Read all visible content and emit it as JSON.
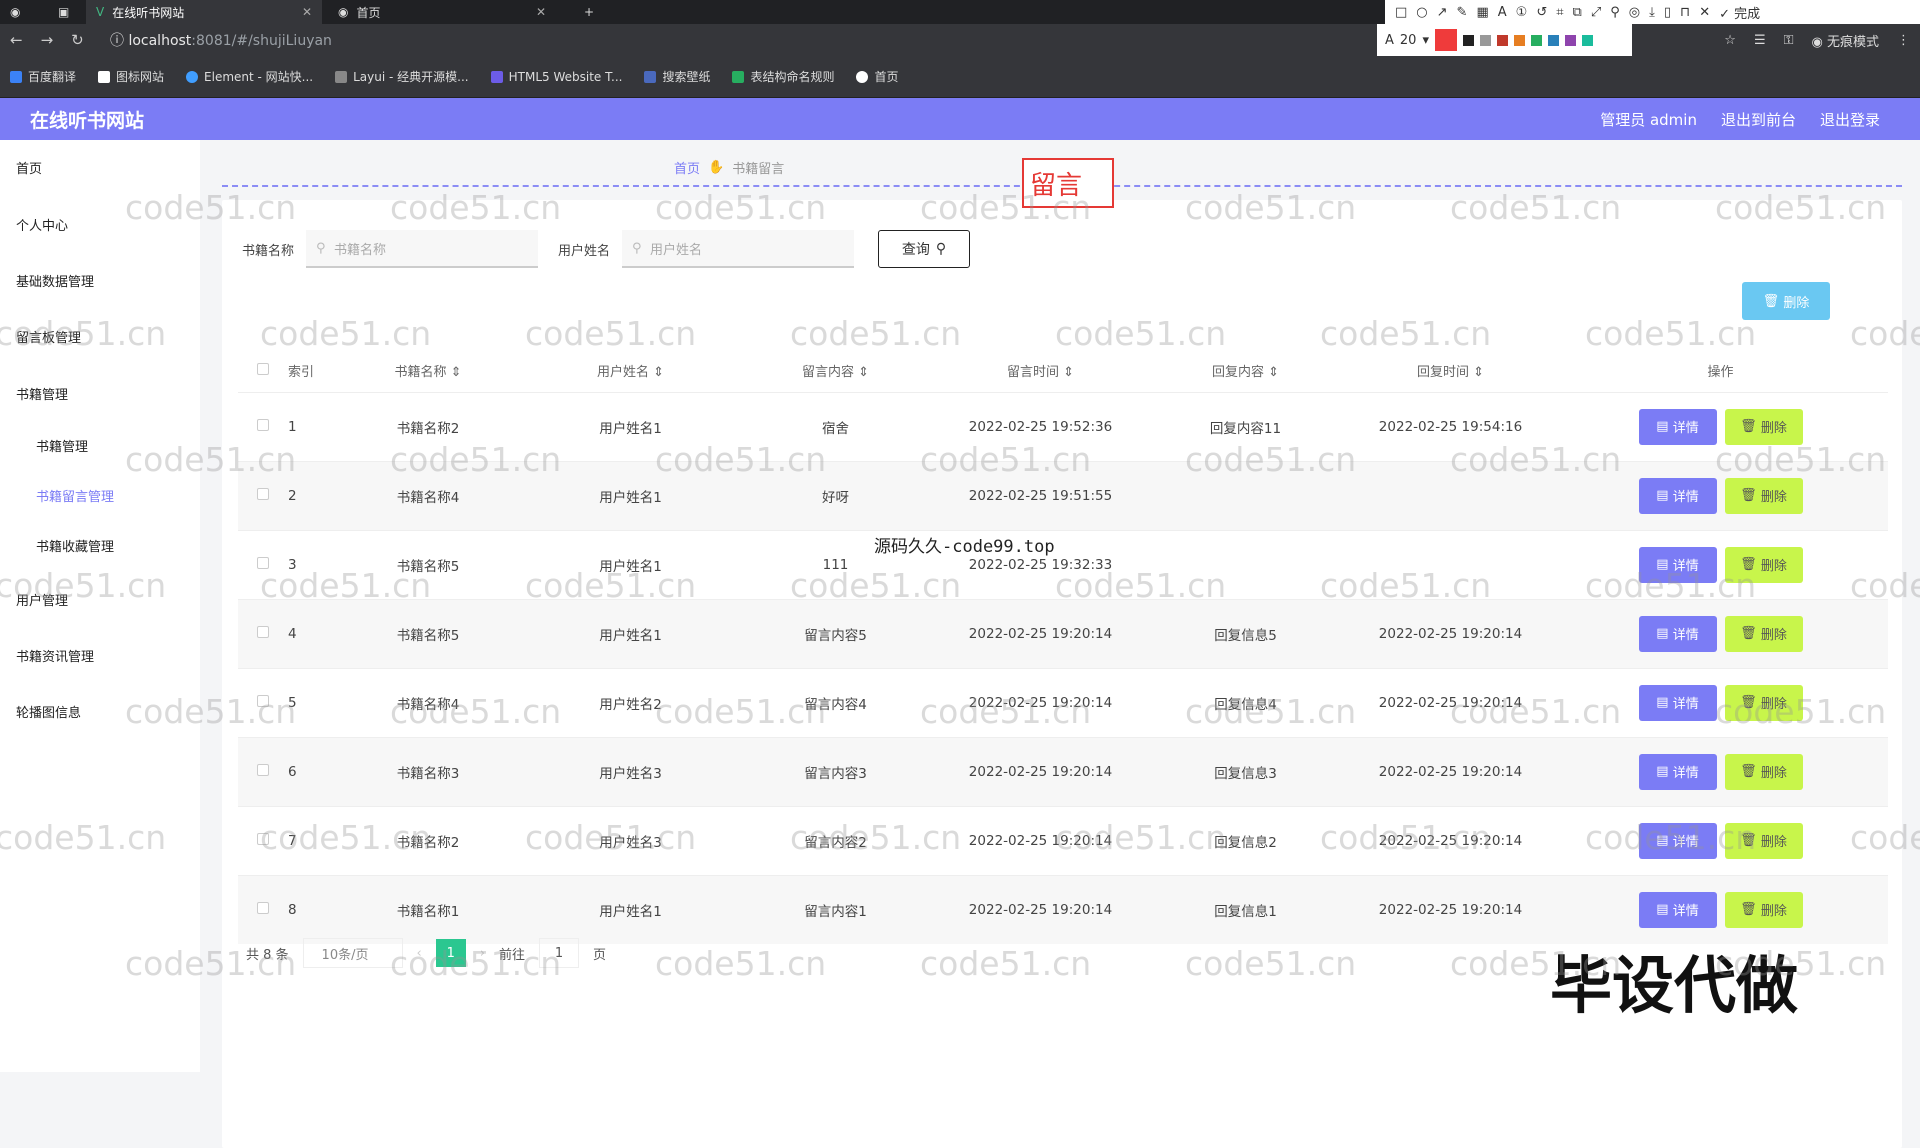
{
  "browser": {
    "tabs": [
      {
        "title": "在线听书网站"
      },
      {
        "title": "首页"
      }
    ],
    "url_host": "localhost",
    "url_path": ":8081/#/shujiLiuyan",
    "font_size": "20",
    "profile": "无痕模式",
    "done": "完成",
    "bookmarks": [
      "百度翻译",
      "图标网站",
      "Element - 网站快...",
      "Layui - 经典开源模...",
      "HTML5 Website T...",
      "搜索壁纸",
      "表结构命名规则",
      "首页"
    ]
  },
  "app": {
    "brand": "在线听书网站",
    "header_links": [
      "管理员 admin",
      "退出到前台",
      "退出登录"
    ]
  },
  "sidebar": {
    "items": [
      {
        "label": "首页",
        "level": 1,
        "active": false
      },
      {
        "label": "个人中心",
        "level": 1,
        "active": false
      },
      {
        "label": "基础数据管理",
        "level": 1,
        "active": false
      },
      {
        "label": "留言板管理",
        "level": 1,
        "active": false
      },
      {
        "label": "书籍管理",
        "level": 1,
        "active": false
      },
      {
        "label": "书籍管理",
        "level": 2,
        "active": false
      },
      {
        "label": "书籍留言管理",
        "level": 2,
        "active": true
      },
      {
        "label": "书籍收藏管理",
        "level": 2,
        "active": false
      },
      {
        "label": "用户管理",
        "level": 1,
        "active": false
      },
      {
        "label": "书籍资讯管理",
        "level": 1,
        "active": false
      },
      {
        "label": "轮播图信息",
        "level": 1,
        "active": false
      }
    ]
  },
  "breadcrumb": {
    "home": "首页",
    "current": "书籍留言"
  },
  "filters": {
    "book_label": "书籍名称",
    "book_placeholder": "书籍名称",
    "user_label": "用户姓名",
    "user_placeholder": "用户姓名",
    "search_label": "查询"
  },
  "annotation_text": "留言",
  "bulk_delete_label": "删除",
  "table": {
    "headers": [
      "索引",
      "书籍名称",
      "用户姓名",
      "留言内容",
      "留言时间",
      "回复内容",
      "回复时间",
      "操作"
    ],
    "detail_label": "详情",
    "delete_label": "删除",
    "rows": [
      [
        "1",
        "书籍名称2",
        "用户姓名1",
        "宿舍",
        "2022-02-25 19:52:36",
        "回复内容11",
        "2022-02-25 19:54:16"
      ],
      [
        "2",
        "书籍名称4",
        "用户姓名1",
        "好呀",
        "2022-02-25 19:51:55",
        "",
        ""
      ],
      [
        "3",
        "书籍名称5",
        "用户姓名1",
        "111",
        "2022-02-25 19:32:33",
        "",
        ""
      ],
      [
        "4",
        "书籍名称5",
        "用户姓名1",
        "留言内容5",
        "2022-02-25 19:20:14",
        "回复信息5",
        "2022-02-25 19:20:14"
      ],
      [
        "5",
        "书籍名称4",
        "用户姓名2",
        "留言内容4",
        "2022-02-25 19:20:14",
        "回复信息4",
        "2022-02-25 19:20:14"
      ],
      [
        "6",
        "书籍名称3",
        "用户姓名3",
        "留言内容3",
        "2022-02-25 19:20:14",
        "回复信息3",
        "2022-02-25 19:20:14"
      ],
      [
        "7",
        "书籍名称2",
        "用户姓名3",
        "留言内容2",
        "2022-02-25 19:20:14",
        "回复信息2",
        "2022-02-25 19:20:14"
      ],
      [
        "8",
        "书籍名称1",
        "用户姓名1",
        "留言内容1",
        "2022-02-25 19:20:14",
        "回复信息1",
        "2022-02-25 19:20:14"
      ]
    ]
  },
  "pager": {
    "total": "共 8 条",
    "size": "10条/页",
    "current": "1",
    "goto_label": "前往",
    "goto_value": "1",
    "page_unit": "页"
  },
  "watermarks": {
    "site": "code51.cn",
    "center": "源码久久-code99.top",
    "big": "毕设代做"
  }
}
